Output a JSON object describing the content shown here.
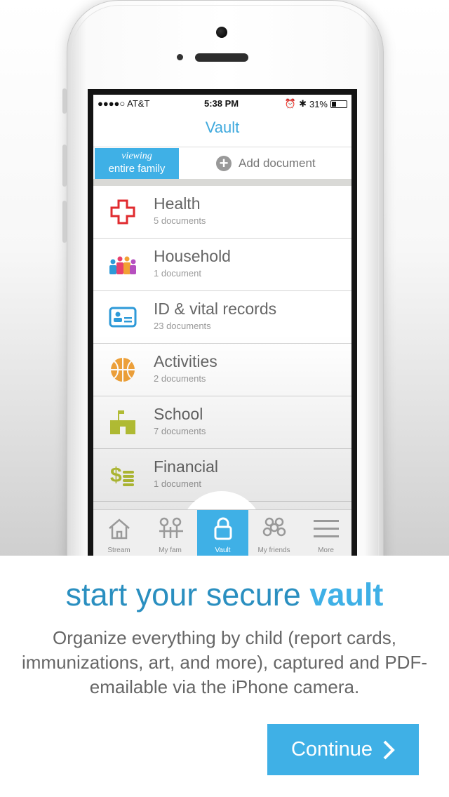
{
  "status_bar": {
    "carrier": "●●●●○ AT&T",
    "time": "5:38 PM",
    "battery": "31%"
  },
  "nav": {
    "title": "Vault"
  },
  "filter": {
    "viewing_label": "viewing",
    "scope": "entire family",
    "add_label": "Add document"
  },
  "categories": [
    {
      "title": "Health",
      "subtitle": "5 documents",
      "icon": "red-cross-icon"
    },
    {
      "title": "Household",
      "subtitle": "1 document",
      "icon": "family-icon"
    },
    {
      "title": "ID & vital records",
      "subtitle": "23 documents",
      "icon": "id-card-icon"
    },
    {
      "title": "Activities",
      "subtitle": "2 documents",
      "icon": "basketball-icon"
    },
    {
      "title": "School",
      "subtitle": "7 documents",
      "icon": "school-icon"
    },
    {
      "title": "Financial",
      "subtitle": "1 document",
      "icon": "money-icon"
    }
  ],
  "tabs": [
    {
      "label": "Stream",
      "icon": "house-icon"
    },
    {
      "label": "My fam",
      "icon": "family-tab-icon"
    },
    {
      "label": "Vault",
      "icon": "lock-icon",
      "active": true
    },
    {
      "label": "My friends",
      "icon": "friends-icon"
    },
    {
      "label": "More",
      "icon": "menu-icon"
    }
  ],
  "promo": {
    "headline_start": "start your secure ",
    "headline_bold": "vault",
    "description": "Organize everything by child (report cards, immunizations, art, and more), captured and PDF-emailable via the iPhone camera.",
    "continue_label": "Continue"
  },
  "colors": {
    "accent": "#3fb0e6",
    "headline": "#2a8fc0"
  }
}
